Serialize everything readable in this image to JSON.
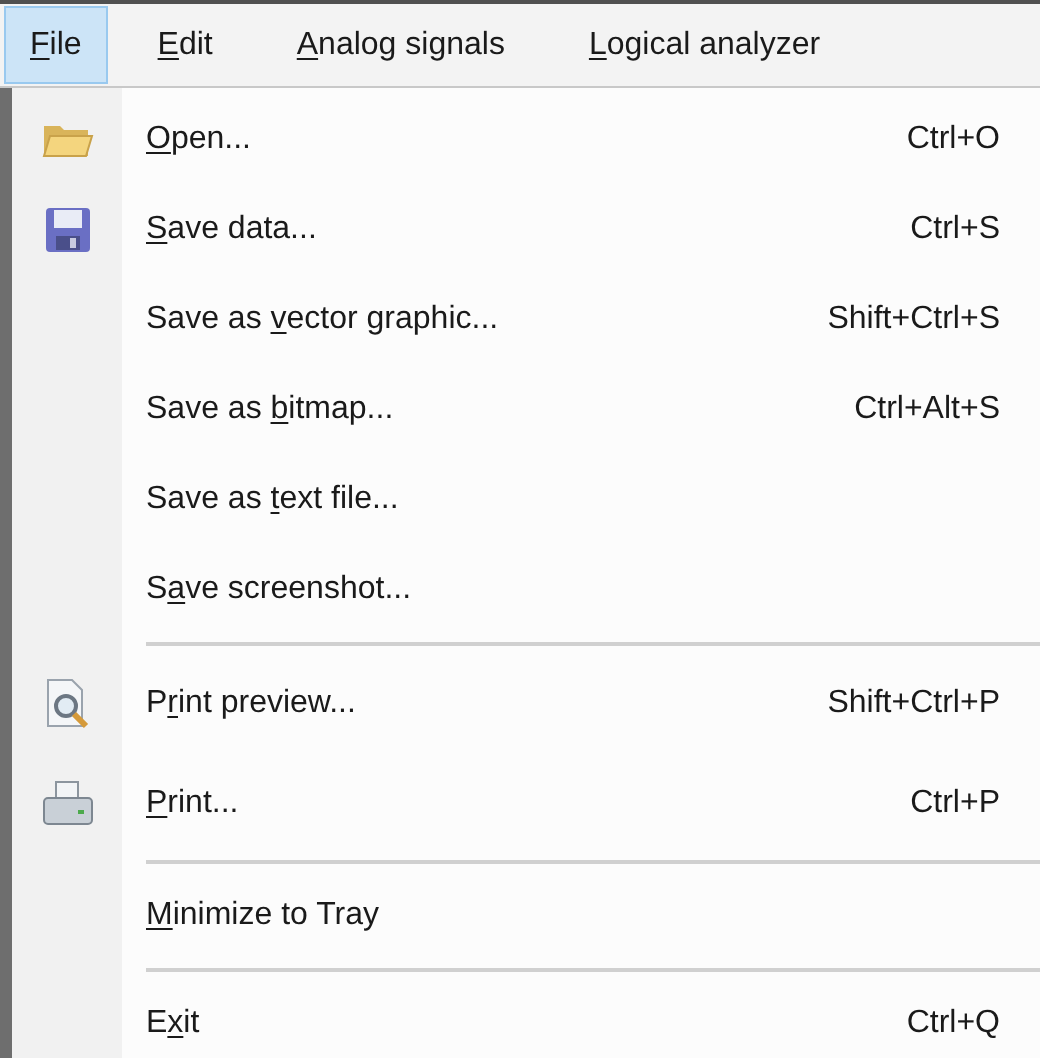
{
  "menu_bar": [
    {
      "key": "F",
      "after": "ile",
      "selected": true
    },
    {
      "key": "E",
      "after": "dit",
      "selected": false
    },
    {
      "key": "A",
      "after": "nalog signals",
      "selected": false
    },
    {
      "key": "L",
      "after": "ogical analyzer",
      "selected": false
    }
  ],
  "menu": [
    {
      "kind": "folder",
      "key": "O",
      "after": "pen...",
      "shortcut": "Ctrl+O"
    },
    {
      "kind": "floppy",
      "key": "S",
      "after": "ave data...",
      "shortcut": "Ctrl+S"
    },
    {
      "kind": "text",
      "before": "Save as ",
      "key": "v",
      "after": "ector graphic...",
      "shortcut": "Shift+Ctrl+S"
    },
    {
      "kind": "text",
      "before": "Save as ",
      "key": "b",
      "after": "itmap...",
      "shortcut": "Ctrl+Alt+S"
    },
    {
      "kind": "text",
      "before": "Save as ",
      "key": "t",
      "after": "ext file..."
    },
    {
      "kind": "text",
      "before": "S",
      "key": "a",
      "after": "ve screenshot..."
    },
    {
      "kind": "separator"
    },
    {
      "kind": "preview",
      "before": "P",
      "key": "r",
      "after": "int preview...",
      "shortcut": "Shift+Ctrl+P"
    },
    {
      "kind": "printer",
      "key": "P",
      "after": "rint...",
      "shortcut": "Ctrl+P"
    },
    {
      "kind": "separator"
    },
    {
      "kind": "text",
      "key": "M",
      "after": "inimize to Tray"
    },
    {
      "kind": "separator"
    },
    {
      "kind": "text",
      "before": "E",
      "key": "x",
      "after": "it",
      "shortcut": "Ctrl+Q"
    }
  ]
}
